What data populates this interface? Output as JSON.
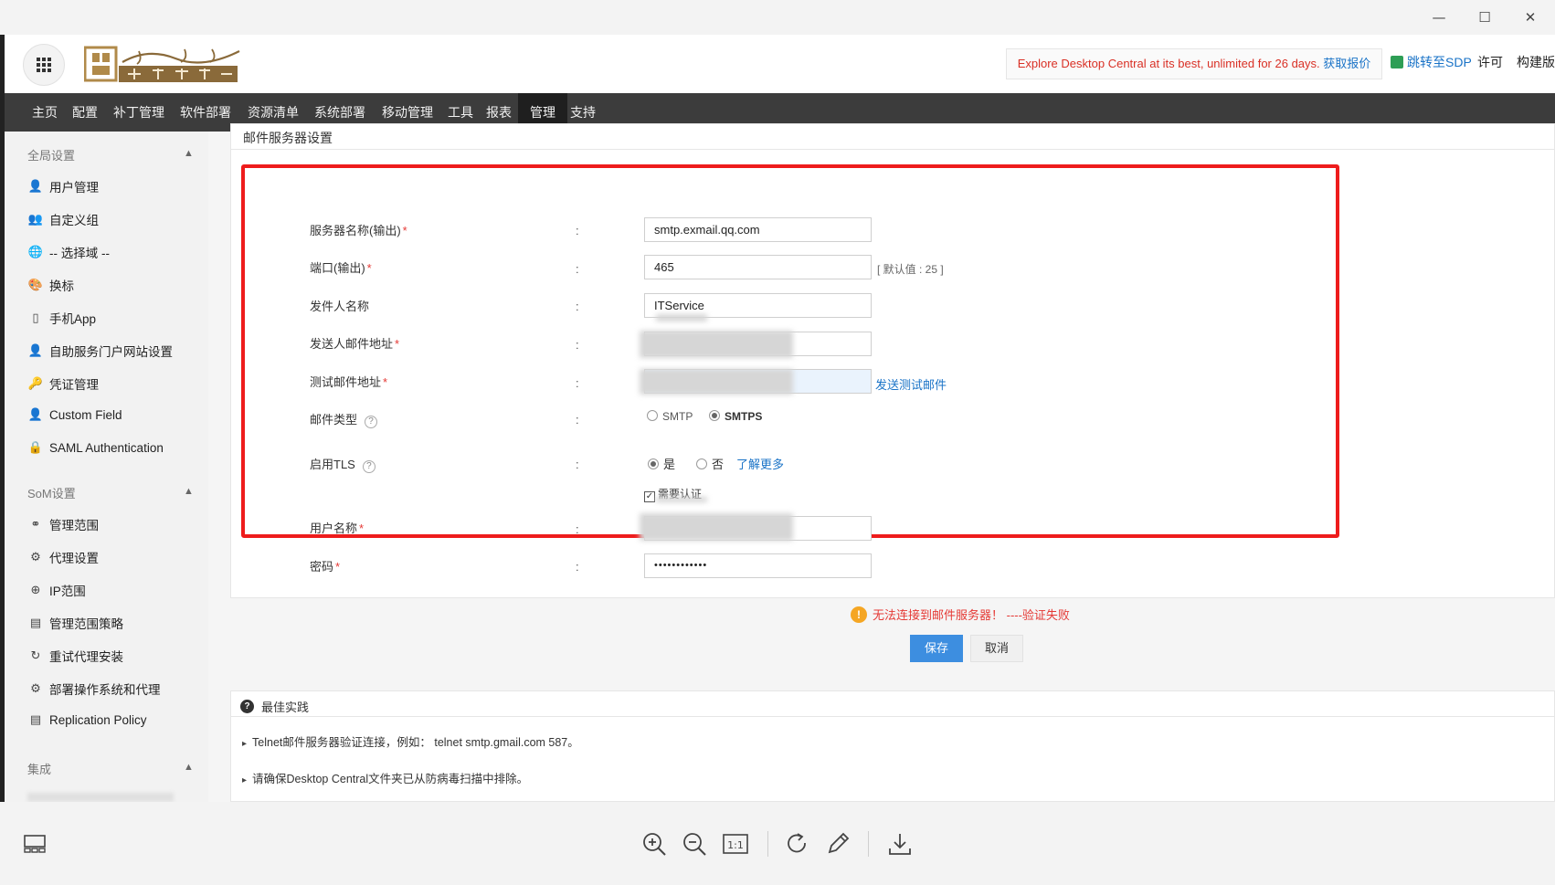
{
  "header": {
    "trial_text": "Explore Desktop Central at its best, unlimited for 26 days.",
    "trial_link": "获取报价",
    "jump_sdp": "跳转至SDP",
    "license": "许可",
    "build": "构建版本"
  },
  "menu": [
    "主页",
    "配置",
    "补丁管理",
    "软件部署",
    "资源清单",
    "系统部署",
    "移动管理",
    "工具",
    "报表",
    "管理",
    "支持"
  ],
  "sidebar": {
    "sections": [
      {
        "title": "全局设置",
        "items": [
          {
            "icon": "user-icon",
            "label": "用户管理"
          },
          {
            "icon": "user-group-icon",
            "label": "自定义组"
          },
          {
            "icon": "globe-icon",
            "label": "-- 选择域 --"
          },
          {
            "icon": "palette-icon",
            "label": "换标"
          },
          {
            "icon": "phone-icon",
            "label": "手机App"
          },
          {
            "icon": "portal-icon",
            "label": "自助服务门户网站设置"
          },
          {
            "icon": "key-icon",
            "label": "凭证管理"
          },
          {
            "icon": "custom-field-icon",
            "label": "Custom Field"
          },
          {
            "icon": "lock-icon",
            "label": "SAML Authentication"
          }
        ]
      },
      {
        "title": "SoM设置",
        "items": [
          {
            "icon": "binoculars-icon",
            "label": "管理范围"
          },
          {
            "icon": "agent-gear-icon",
            "label": "代理设置"
          },
          {
            "icon": "ip-icon",
            "label": "IP范围"
          },
          {
            "icon": "policy-icon",
            "label": "管理范围策略"
          },
          {
            "icon": "retry-icon",
            "label": "重试代理安装"
          },
          {
            "icon": "deploy-icon",
            "label": "部署操作系统和代理"
          },
          {
            "icon": "replication-icon",
            "label": "Replication Policy"
          }
        ]
      },
      {
        "title": "集成",
        "items": []
      }
    ]
  },
  "panel": {
    "title": "邮件服务器设置",
    "fields": {
      "server_name": {
        "label": "服务器名称(输出)",
        "value": "smtp.exmail.qq.com"
      },
      "port": {
        "label": "端口(输出)",
        "value": "465",
        "hint": "[ 默认值 : 25 ]"
      },
      "sender_name": {
        "label": "发件人名称",
        "value": "ITService"
      },
      "sender_address": {
        "label": "发送人邮件地址"
      },
      "test_address": {
        "label": "测试邮件地址",
        "action": "发送测试邮件"
      },
      "mail_type": {
        "label": "邮件类型",
        "options": [
          "SMTP",
          "SMTPS"
        ],
        "selected": "SMTPS"
      },
      "tls": {
        "label": "启用TLS",
        "options": [
          "是",
          "否"
        ],
        "selected": "是",
        "learn_more": "了解更多"
      },
      "auth": {
        "label": "需要认证",
        "checked": true
      },
      "username": {
        "label": "用户名称"
      },
      "password": {
        "label": "密码",
        "value": "••••••••••••"
      }
    },
    "colon": ":",
    "error": "无法连接到邮件服务器！ ----验证失败",
    "save": "保存",
    "cancel": "取消"
  },
  "best_practice": {
    "title": "最佳实践",
    "items": [
      "Telnet邮件服务器验证连接，例如： telnet smtp.gmail.com 587。",
      "请确保Desktop Central文件夹已从防病毒扫描中排除。"
    ]
  },
  "colors": {
    "menubar": "#3c3c3c",
    "accent": "#3d8ee0",
    "error": "#e53935",
    "highlight_frame": "#ee1c1c"
  }
}
